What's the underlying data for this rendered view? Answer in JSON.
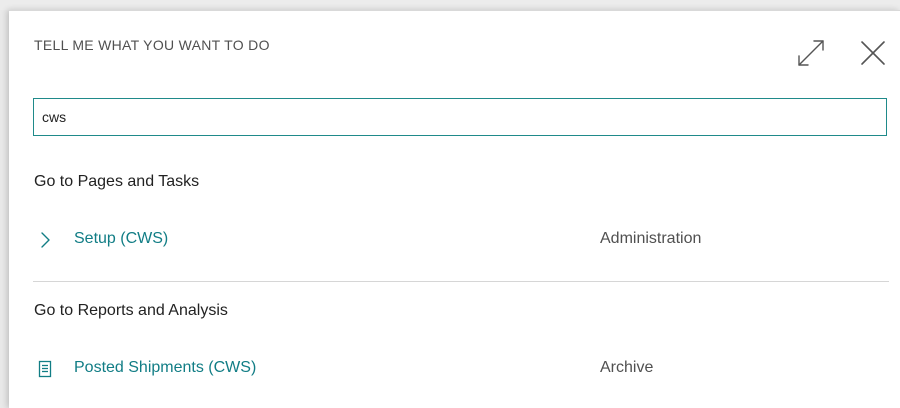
{
  "dialog": {
    "title": "TELL ME WHAT YOU WANT TO DO",
    "expand_icon": "expand-icon",
    "close_icon": "close-icon"
  },
  "search": {
    "value": "cws",
    "placeholder": ""
  },
  "sections": [
    {
      "title": "Go to Pages and Tasks",
      "results": [
        {
          "label": "Setup (CWS)",
          "category": "Administration",
          "icon": "chevron-right-icon"
        }
      ]
    },
    {
      "title": "Go to Reports and Analysis",
      "results": [
        {
          "label": "Posted Shipments (CWS)",
          "category": "Archive",
          "icon": "report-icon"
        }
      ]
    }
  ],
  "colors": {
    "accent": "#117d85",
    "search_border": "#1f8a8a",
    "text": "#222222",
    "muted_text": "#505050"
  }
}
